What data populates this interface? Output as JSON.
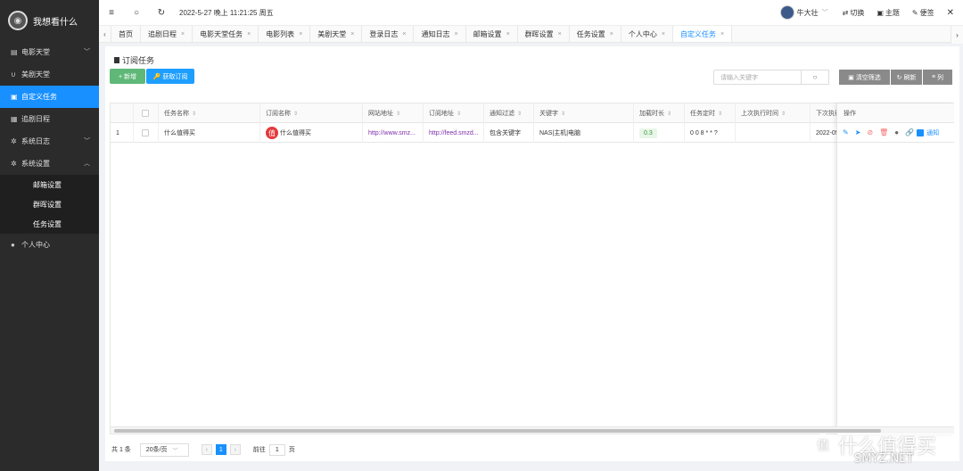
{
  "sidebar": {
    "title": "我想看什么",
    "items": [
      {
        "label": "电影天堂",
        "icon": "file-icon",
        "arrow": "﹀"
      },
      {
        "label": "美剧天堂",
        "icon": "magnet-icon",
        "arrow": ""
      },
      {
        "label": "自定义任务",
        "icon": "clipboard-icon",
        "arrow": ""
      },
      {
        "label": "追剧日程",
        "icon": "calendar-icon",
        "arrow": ""
      },
      {
        "label": "系统日志",
        "icon": "gear-icon",
        "arrow": "﹀"
      },
      {
        "label": "系统设置",
        "icon": "gear-icon",
        "arrow": "︿"
      }
    ],
    "sub_items": [
      "邮箱设置",
      "群晖设置",
      "任务设置"
    ],
    "last_item": "个人中心"
  },
  "header": {
    "datetime": "2022-5-27 晚上 11:21:25 周五",
    "user": "牛大壮",
    "switch_label": "切换",
    "theme_label": "主题",
    "note_label": "便签"
  },
  "tabs": [
    "首页",
    "追剧日程",
    "电影天堂任务",
    "电影列表",
    "美剧天堂",
    "登录日志",
    "通知日志",
    "邮箱设置",
    "群晖设置",
    "任务设置",
    "个人中心",
    "自定义任务"
  ],
  "active_tab": "自定义任务",
  "panel": {
    "title": "订阅任务",
    "add_label": "+ 新增",
    "fetch_label": "🔑 获取订阅",
    "search_placeholder": "请输入关键字",
    "clear_label": "清空筛选",
    "refresh_label": "刷新",
    "columns_label": "列"
  },
  "table": {
    "headers": [
      "任务名称",
      "订阅名称",
      "网站地址",
      "订阅地址",
      "通知过滤",
      "关键字",
      "加载时长",
      "任务定时",
      "上次执行时间",
      "下次执行"
    ],
    "action_header": "操作",
    "rows": [
      {
        "index": "1",
        "task_name": "什么值得买",
        "sub_logo": "值",
        "sub_name": "什么值得买",
        "site_url": "http://www.smz...",
        "feed_url": "http://feed.smzd...",
        "filter": "包含关键字",
        "keywords": "NAS|主机|电脑",
        "load_time": "0.3",
        "cron": "0 0 8 * * ?",
        "last_run": "",
        "next_run": "2022-05",
        "notify_label": "通知"
      }
    ]
  },
  "pager": {
    "total": "共 1 条",
    "page_size": "20条/页",
    "current": "1",
    "goto_label": "前往",
    "goto_value": "1",
    "page_unit": "页"
  },
  "watermark": {
    "badge": "值",
    "text": "什么值得买",
    "sub": "SMYZ.NET"
  }
}
